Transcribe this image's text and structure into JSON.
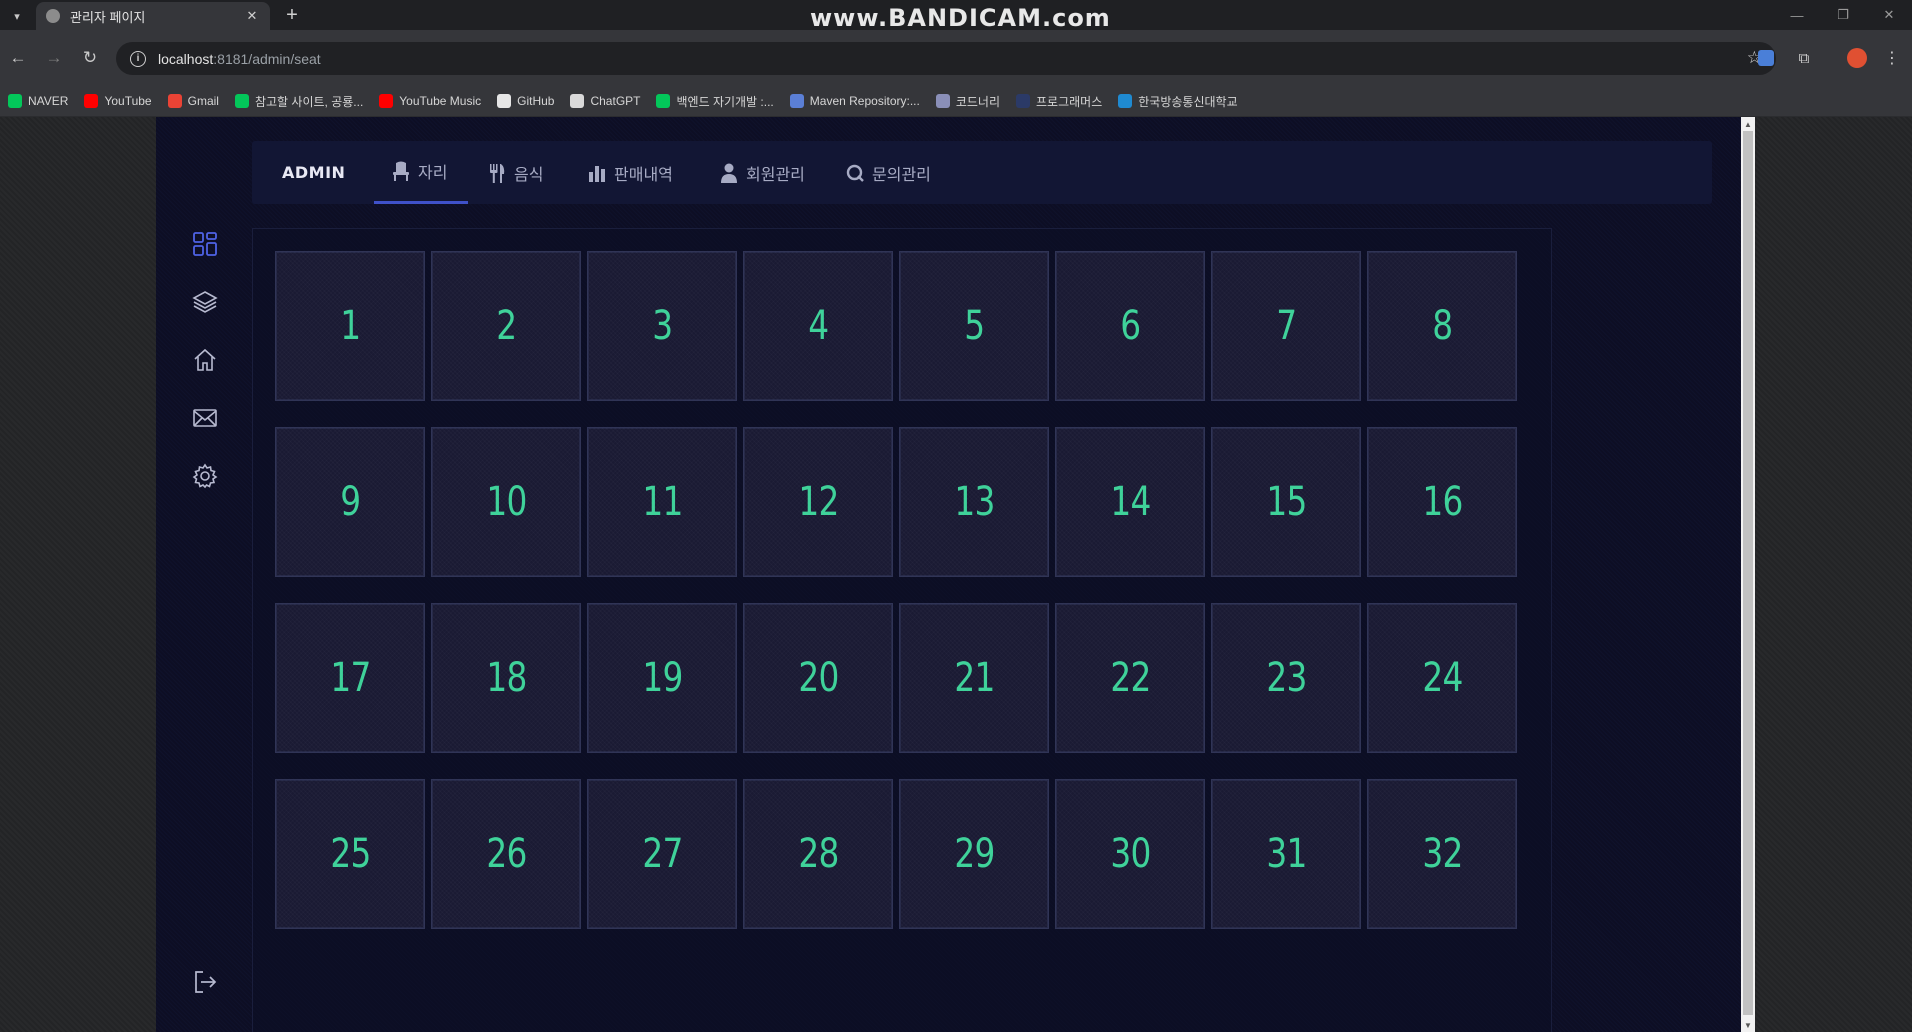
{
  "browser": {
    "tab_title": "관리자 페이지",
    "tab_close": "✕",
    "new_tab": "+",
    "watermark": "www.BANDICAM.com",
    "url_host": "localhost",
    "url_rest": ":8181/admin/seat",
    "bookmarks": [
      {
        "label": "NAVER",
        "color": "#03c75a"
      },
      {
        "label": "YouTube",
        "color": "#ff0000"
      },
      {
        "label": "Gmail",
        "color": "#ea4335"
      },
      {
        "label": "참고할 사이트, 공룡...",
        "color": "#03c75a"
      },
      {
        "label": "YouTube Music",
        "color": "#ff0000"
      },
      {
        "label": "GitHub",
        "color": "#e6e6e6"
      },
      {
        "label": "ChatGPT",
        "color": "#d9d9d9"
      },
      {
        "label": "백엔드 자기개발 :...",
        "color": "#03c75a"
      },
      {
        "label": "Maven Repository:...",
        "color": "#5b7fd6"
      },
      {
        "label": "코드너리",
        "color": "#8a8fb8"
      },
      {
        "label": "프로그래머스",
        "color": "#2b3a67"
      },
      {
        "label": "한국방송통신대학교",
        "color": "#1f8ad1"
      }
    ]
  },
  "app": {
    "brand": "ADMIN",
    "nav": [
      {
        "label": "자리",
        "icon": "seat-icon",
        "active": true
      },
      {
        "label": "음식",
        "icon": "utensils-icon",
        "active": false
      },
      {
        "label": "판매내역",
        "icon": "bar-chart-icon",
        "active": false
      },
      {
        "label": "회원관리",
        "icon": "user-icon",
        "active": false
      },
      {
        "label": "문의관리",
        "icon": "inquiry-icon",
        "active": false
      }
    ],
    "sidebar": [
      "dashboard-icon",
      "layers-icon",
      "home-icon",
      "mail-icon",
      "settings-icon",
      "logout-icon"
    ],
    "colors": {
      "accent": "#3f51c9",
      "seat_number": "#3fd29a",
      "background": "#0d0e24"
    },
    "seats": [
      "1",
      "2",
      "3",
      "4",
      "5",
      "6",
      "7",
      "8",
      "9",
      "10",
      "11",
      "12",
      "13",
      "14",
      "15",
      "16",
      "17",
      "18",
      "19",
      "20",
      "21",
      "22",
      "23",
      "24",
      "25",
      "26",
      "27",
      "28",
      "29",
      "30",
      "31",
      "32"
    ]
  }
}
